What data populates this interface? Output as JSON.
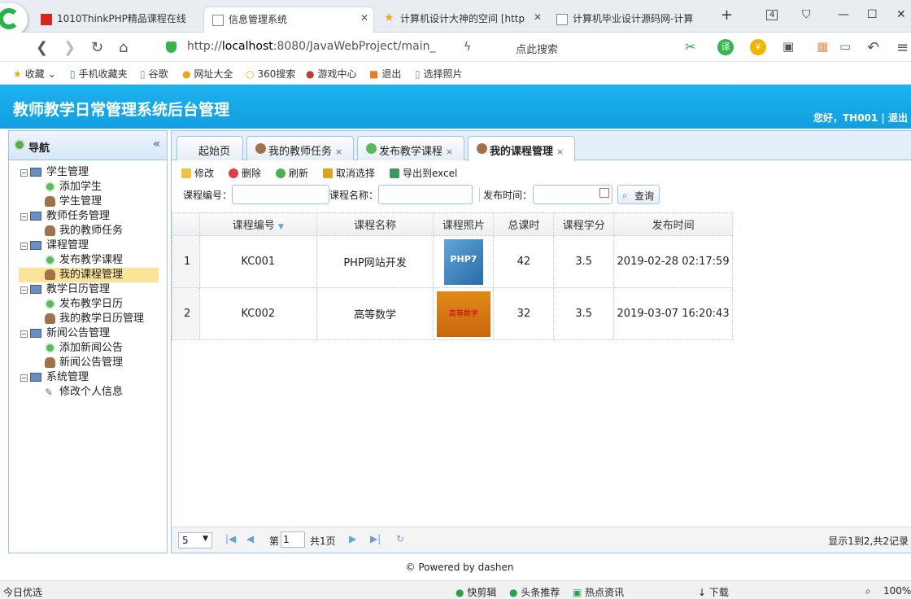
{
  "browser": {
    "tabs": [
      {
        "label": "1010ThinkPHP精品课程在线"
      },
      {
        "label": "信息管理系统"
      },
      {
        "label": "计算机设计大神的空间 [http"
      },
      {
        "label": "计算机毕业设计源码网-计算"
      }
    ],
    "tab_count": "4",
    "url_host": "http://",
    "url_bold": "localhost",
    "url_rest": ":8080/JavaWebProject/main_",
    "search_placeholder": "点此搜索",
    "bookmarks": [
      {
        "label": "收藏"
      },
      {
        "label": "手机收藏夹"
      },
      {
        "label": "谷歌"
      },
      {
        "label": "网址大全"
      },
      {
        "label": "360搜索"
      },
      {
        "label": "游戏中心"
      },
      {
        "label": "退出"
      },
      {
        "label": "选择照片"
      }
    ]
  },
  "app": {
    "title": "教师教学日常管理系统后台管理",
    "user_info": "您好，TH001 | 退出"
  },
  "sidebar": {
    "title": "导航",
    "collapse": "«",
    "groups": [
      {
        "label": "学生管理",
        "items": [
          "添加学生",
          "学生管理"
        ]
      },
      {
        "label": "教师任务管理",
        "items": [
          "我的教师任务"
        ]
      },
      {
        "label": "课程管理",
        "items": [
          "发布教学课程",
          "我的课程管理"
        ]
      },
      {
        "label": "教学日历管理",
        "items": [
          "发布教学日历",
          "我的教学日历管理"
        ]
      },
      {
        "label": "新闻公告管理",
        "items": [
          "添加新闻公告",
          "新闻公告管理"
        ]
      },
      {
        "label": "系统管理",
        "items": [
          "修改个人信息"
        ]
      }
    ]
  },
  "content_tabs": [
    {
      "label": "起始页"
    },
    {
      "label": "我的教师任务",
      "close": "×"
    },
    {
      "label": "发布教学课程",
      "close": "×"
    },
    {
      "label": "我的课程管理",
      "close": "×"
    }
  ],
  "toolbar": {
    "edit": "修改",
    "delete": "删除",
    "refresh": "刷新",
    "cancel": "取消选择",
    "export": "导出到excel"
  },
  "search": {
    "code_label": "课程编号：",
    "name_label": "课程名称：",
    "time_label": "发布时间：",
    "query": "查询"
  },
  "table": {
    "headers": [
      "课程编号",
      "课程名称",
      "课程照片",
      "总课时",
      "课程学分",
      "发布时间"
    ],
    "rows": [
      {
        "no": "1",
        "code": "KC001",
        "name": "PHP网站开发",
        "photo": "PHP7",
        "hours": "42",
        "credit": "3.5",
        "time": "2019-02-28 02:17:59"
      },
      {
        "no": "2",
        "code": "KC002",
        "name": "高等数学",
        "photo": "高等数学",
        "hours": "32",
        "credit": "3.5",
        "time": "2019-03-07 16:20:43"
      }
    ]
  },
  "pager": {
    "size": "5",
    "page_prefix": "第",
    "page": "1",
    "page_total": "共1页",
    "info": "显示1到2,共2记录"
  },
  "footer": "© Powered by dashen",
  "status": {
    "left": "今日优选",
    "items": [
      "快剪辑",
      "头条推荐",
      "热点资讯",
      "下载"
    ],
    "zoom": "100%"
  }
}
